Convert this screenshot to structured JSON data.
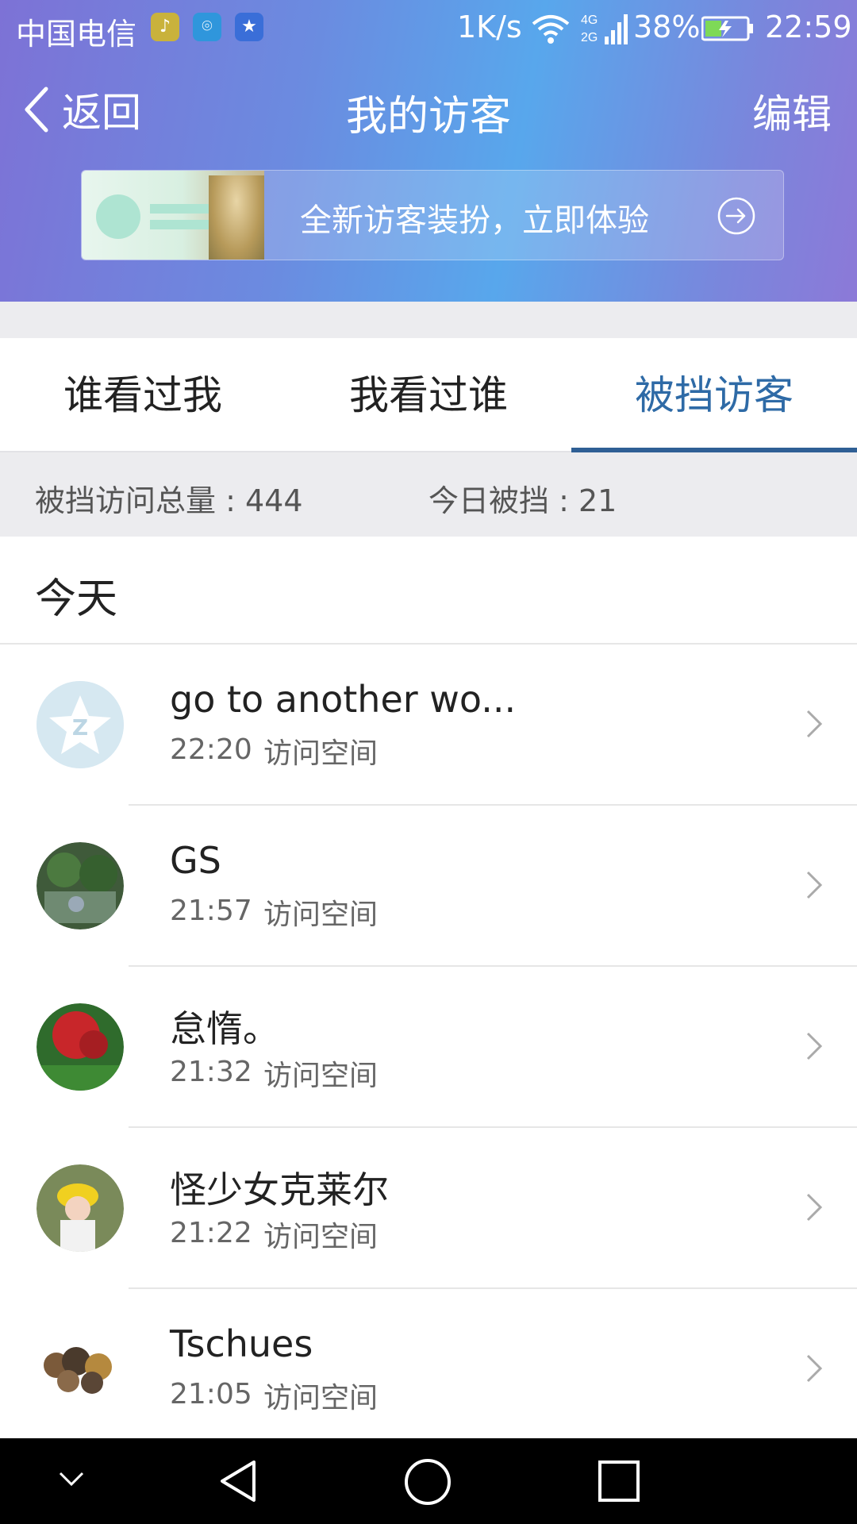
{
  "status_bar": {
    "carrier": "中国电信",
    "speed": "1K/s",
    "network": "4G 2G",
    "battery": "38%",
    "time": "22:59"
  },
  "nav": {
    "back_label": "返回",
    "title": "我的访客",
    "edit_label": "编辑"
  },
  "banner": {
    "text": "全新访客装扮，立即体验"
  },
  "tabs": [
    {
      "label": "谁看过我",
      "active": false
    },
    {
      "label": "我看过谁",
      "active": false
    },
    {
      "label": "被挡访客",
      "active": true
    }
  ],
  "stats": {
    "total": "被挡访问总量 : 444",
    "today": "今日被挡 : 21"
  },
  "section": {
    "title": "今天"
  },
  "visitors": [
    {
      "name": "go to another wo...",
      "time": "22:20",
      "action": "访问空间"
    },
    {
      "name": "GS",
      "time": "21:57",
      "action": "访问空间"
    },
    {
      "name": "怠惰。",
      "time": "21:32",
      "action": "访问空间"
    },
    {
      "name": "怪少女克莱尔",
      "time": "21:22",
      "action": "访问空间"
    },
    {
      "name": "Tschues",
      "time": "21:05",
      "action": "访问空间"
    }
  ],
  "colors": {
    "accent": "#2e6aa6",
    "tab_underline": "#2f5f95"
  }
}
